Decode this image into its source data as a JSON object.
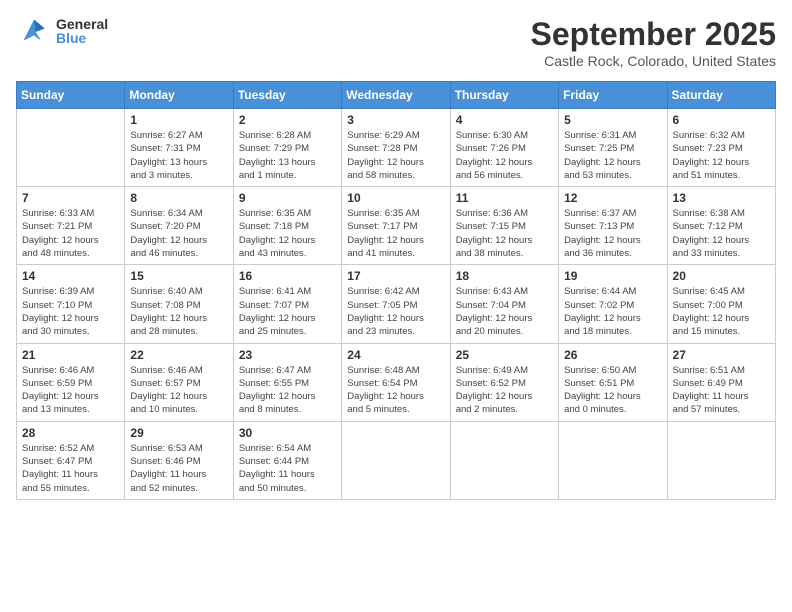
{
  "header": {
    "logo_general": "General",
    "logo_blue": "Blue",
    "month_title": "September 2025",
    "location": "Castle Rock, Colorado, United States"
  },
  "columns": [
    "Sunday",
    "Monday",
    "Tuesday",
    "Wednesday",
    "Thursday",
    "Friday",
    "Saturday"
  ],
  "weeks": [
    [
      {
        "day": "",
        "info": ""
      },
      {
        "day": "1",
        "info": "Sunrise: 6:27 AM\nSunset: 7:31 PM\nDaylight: 13 hours\nand 3 minutes."
      },
      {
        "day": "2",
        "info": "Sunrise: 6:28 AM\nSunset: 7:29 PM\nDaylight: 13 hours\nand 1 minute."
      },
      {
        "day": "3",
        "info": "Sunrise: 6:29 AM\nSunset: 7:28 PM\nDaylight: 12 hours\nand 58 minutes."
      },
      {
        "day": "4",
        "info": "Sunrise: 6:30 AM\nSunset: 7:26 PM\nDaylight: 12 hours\nand 56 minutes."
      },
      {
        "day": "5",
        "info": "Sunrise: 6:31 AM\nSunset: 7:25 PM\nDaylight: 12 hours\nand 53 minutes."
      },
      {
        "day": "6",
        "info": "Sunrise: 6:32 AM\nSunset: 7:23 PM\nDaylight: 12 hours\nand 51 minutes."
      }
    ],
    [
      {
        "day": "7",
        "info": "Sunrise: 6:33 AM\nSunset: 7:21 PM\nDaylight: 12 hours\nand 48 minutes."
      },
      {
        "day": "8",
        "info": "Sunrise: 6:34 AM\nSunset: 7:20 PM\nDaylight: 12 hours\nand 46 minutes."
      },
      {
        "day": "9",
        "info": "Sunrise: 6:35 AM\nSunset: 7:18 PM\nDaylight: 12 hours\nand 43 minutes."
      },
      {
        "day": "10",
        "info": "Sunrise: 6:35 AM\nSunset: 7:17 PM\nDaylight: 12 hours\nand 41 minutes."
      },
      {
        "day": "11",
        "info": "Sunrise: 6:36 AM\nSunset: 7:15 PM\nDaylight: 12 hours\nand 38 minutes."
      },
      {
        "day": "12",
        "info": "Sunrise: 6:37 AM\nSunset: 7:13 PM\nDaylight: 12 hours\nand 36 minutes."
      },
      {
        "day": "13",
        "info": "Sunrise: 6:38 AM\nSunset: 7:12 PM\nDaylight: 12 hours\nand 33 minutes."
      }
    ],
    [
      {
        "day": "14",
        "info": "Sunrise: 6:39 AM\nSunset: 7:10 PM\nDaylight: 12 hours\nand 30 minutes."
      },
      {
        "day": "15",
        "info": "Sunrise: 6:40 AM\nSunset: 7:08 PM\nDaylight: 12 hours\nand 28 minutes."
      },
      {
        "day": "16",
        "info": "Sunrise: 6:41 AM\nSunset: 7:07 PM\nDaylight: 12 hours\nand 25 minutes."
      },
      {
        "day": "17",
        "info": "Sunrise: 6:42 AM\nSunset: 7:05 PM\nDaylight: 12 hours\nand 23 minutes."
      },
      {
        "day": "18",
        "info": "Sunrise: 6:43 AM\nSunset: 7:04 PM\nDaylight: 12 hours\nand 20 minutes."
      },
      {
        "day": "19",
        "info": "Sunrise: 6:44 AM\nSunset: 7:02 PM\nDaylight: 12 hours\nand 18 minutes."
      },
      {
        "day": "20",
        "info": "Sunrise: 6:45 AM\nSunset: 7:00 PM\nDaylight: 12 hours\nand 15 minutes."
      }
    ],
    [
      {
        "day": "21",
        "info": "Sunrise: 6:46 AM\nSunset: 6:59 PM\nDaylight: 12 hours\nand 13 minutes."
      },
      {
        "day": "22",
        "info": "Sunrise: 6:46 AM\nSunset: 6:57 PM\nDaylight: 12 hours\nand 10 minutes."
      },
      {
        "day": "23",
        "info": "Sunrise: 6:47 AM\nSunset: 6:55 PM\nDaylight: 12 hours\nand 8 minutes."
      },
      {
        "day": "24",
        "info": "Sunrise: 6:48 AM\nSunset: 6:54 PM\nDaylight: 12 hours\nand 5 minutes."
      },
      {
        "day": "25",
        "info": "Sunrise: 6:49 AM\nSunset: 6:52 PM\nDaylight: 12 hours\nand 2 minutes."
      },
      {
        "day": "26",
        "info": "Sunrise: 6:50 AM\nSunset: 6:51 PM\nDaylight: 12 hours\nand 0 minutes."
      },
      {
        "day": "27",
        "info": "Sunrise: 6:51 AM\nSunset: 6:49 PM\nDaylight: 11 hours\nand 57 minutes."
      }
    ],
    [
      {
        "day": "28",
        "info": "Sunrise: 6:52 AM\nSunset: 6:47 PM\nDaylight: 11 hours\nand 55 minutes."
      },
      {
        "day": "29",
        "info": "Sunrise: 6:53 AM\nSunset: 6:46 PM\nDaylight: 11 hours\nand 52 minutes."
      },
      {
        "day": "30",
        "info": "Sunrise: 6:54 AM\nSunset: 6:44 PM\nDaylight: 11 hours\nand 50 minutes."
      },
      {
        "day": "",
        "info": ""
      },
      {
        "day": "",
        "info": ""
      },
      {
        "day": "",
        "info": ""
      },
      {
        "day": "",
        "info": ""
      }
    ]
  ]
}
